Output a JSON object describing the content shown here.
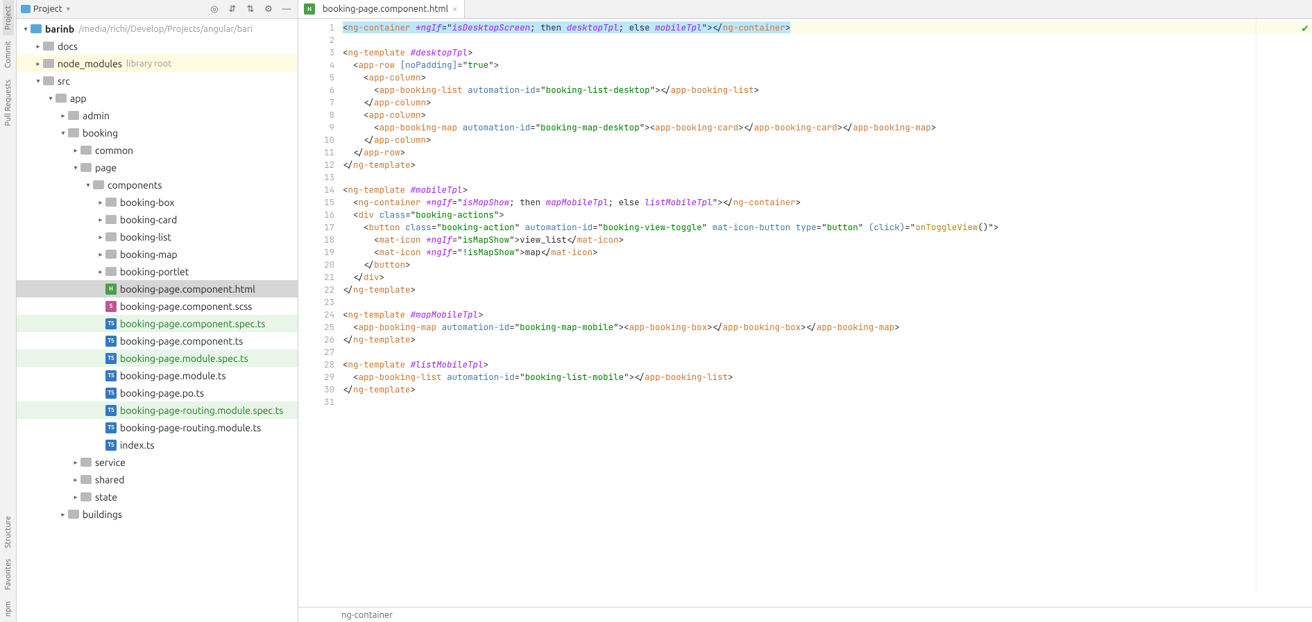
{
  "rail": {
    "top": [
      "Project",
      "Commit",
      "Pull Requests"
    ],
    "bottom": [
      "Structure",
      "Favorites",
      "npm"
    ]
  },
  "panel": {
    "title": "Project"
  },
  "tree": {
    "root": {
      "name": "barinb",
      "path": "/media/richi/Develop/Projects/angular/bari"
    },
    "docs": "docs",
    "node_modules": "node_modules",
    "node_modules_hint": "library root",
    "src": "src",
    "app": "app",
    "admin": "admin",
    "booking": "booking",
    "common": "common",
    "page": "page",
    "components": "components",
    "comp_items": [
      "booking-box",
      "booking-card",
      "booking-list",
      "booking-map",
      "booking-portlet"
    ],
    "files": [
      {
        "n": "booking-page.component.html",
        "t": "html",
        "sel": true
      },
      {
        "n": "booking-page.component.scss",
        "t": "scss"
      },
      {
        "n": "booking-page.component.spec.ts",
        "t": "ts",
        "g": true
      },
      {
        "n": "booking-page.component.ts",
        "t": "ts"
      },
      {
        "n": "booking-page.module.spec.ts",
        "t": "ts",
        "g": true
      },
      {
        "n": "booking-page.module.ts",
        "t": "ts"
      },
      {
        "n": "booking-page.po.ts",
        "t": "ts"
      },
      {
        "n": "booking-page-routing.module.spec.ts",
        "t": "ts",
        "g": true
      },
      {
        "n": "booking-page-routing.module.ts",
        "t": "ts"
      },
      {
        "n": "index.ts",
        "t": "ts"
      }
    ],
    "service": "service",
    "shared": "shared",
    "state": "state",
    "buildings": "buildings"
  },
  "tab": {
    "name": "booking-page.component.html"
  },
  "breadcrumb": "ng-container",
  "code_lines": 31,
  "code": {
    "l1": {
      "pre": "<",
      "tag": "ng-container",
      "sp": " ",
      "dir": "*ngIf",
      "eq": "=\"",
      "v1": "isDesktopScreen",
      "mid": "; then ",
      "v2": "desktopTpl",
      "mid2": "; else ",
      "v3": "mobileTpl",
      "cl": "\"></",
      "tag2": "ng-container",
      "end": ">"
    },
    "l3": {
      "pre": "<",
      "tag": "ng-template",
      "sp": " ",
      "dir": "#desktopTpl",
      "end": ">"
    },
    "l4": {
      "ind": "  ",
      "pre": "<",
      "tag": "app-row",
      "sp": " ",
      "attr": "[noPadding]",
      "eq": "=\"",
      "str": "true",
      "end": "\">"
    },
    "l5": {
      "ind": "    ",
      "pre": "<",
      "tag": "app-column",
      "end": ">"
    },
    "l6": {
      "ind": "      ",
      "pre": "<",
      "tag": "app-booking-list",
      "sp": " ",
      "attr": "automation-id",
      "eq": "=\"",
      "str": "booking-list-desktop",
      "q": "\"></",
      "tag2": "app-booking-list",
      "end": ">"
    },
    "l7": {
      "ind": "    ",
      "pre": "</",
      "tag": "app-column",
      "end": ">"
    },
    "l8": {
      "ind": "    ",
      "pre": "<",
      "tag": "app-column",
      "end": ">"
    },
    "l9": {
      "ind": "      ",
      "pre": "<",
      "tag": "app-booking-map",
      "sp": " ",
      "attr": "automation-id",
      "eq": "=\"",
      "str": "booking-map-desktop",
      "q": "\"><",
      "tag2": "app-booking-card",
      "mid": "></",
      "tag3": "app-booking-card",
      "mid2": "></",
      "tag4": "app-booking-map",
      "end": ">"
    },
    "l10": {
      "ind": "    ",
      "pre": "</",
      "tag": "app-column",
      "end": ">"
    },
    "l11": {
      "ind": "  ",
      "pre": "</",
      "tag": "app-row",
      "end": ">"
    },
    "l12": {
      "pre": "</",
      "tag": "ng-template",
      "end": ">"
    },
    "l14": {
      "pre": "<",
      "tag": "ng-template",
      "sp": " ",
      "dir": "#mobileTpl",
      "end": ">"
    },
    "l15": {
      "ind": "  ",
      "pre": "<",
      "tag": "ng-container",
      "sp": " ",
      "dir": "*ngIf",
      "eq": "=\"",
      "v1": "isMapShow",
      "mid": "; then ",
      "v2": "mapMobileTpl",
      "mid2": "; else ",
      "v3": "listMobileTpl",
      "cl": "\"></",
      "tag2": "ng-container",
      "end": ">"
    },
    "l16": {
      "ind": "  ",
      "pre": "<",
      "tag": "div",
      "sp": " ",
      "attr": "class",
      "eq": "=\"",
      "str": "booking-actions",
      "end": "\">"
    },
    "l17": {
      "ind": "    ",
      "pre": "<",
      "tag": "button",
      "sp": " ",
      "attr": "class",
      "eq": "=\"",
      "str": "booking-action",
      "q": "\" ",
      "attr2": "automation-id",
      "eq2": "=\"",
      "str2": "booking-view-toggle",
      "q2": "\" ",
      "attr3": "mat-icon-button",
      "sp2": " ",
      "attr4": "type",
      "eq3": "=\"",
      "str3": "button",
      "q3": "\" ",
      "attr5": "(click)",
      "eq4": "=\"",
      "func": "onToggleView",
      "paren": "()\"",
      "end": ">"
    },
    "l18": {
      "ind": "      ",
      "pre": "<",
      "tag": "mat-icon",
      "sp": " ",
      "dir": "*ngIf",
      "eq": "=\"",
      "str": "isMapShow",
      "q": "\">",
      "txt": "view_list",
      "cl": "</",
      "tag2": "mat-icon",
      "end": ">"
    },
    "l19": {
      "ind": "      ",
      "pre": "<",
      "tag": "mat-icon",
      "sp": " ",
      "dir": "*ngIf",
      "eq": "=\"",
      "str": "!isMapShow",
      "q": "\">",
      "txt": "map",
      "cl": "</",
      "tag2": "mat-icon",
      "end": ">"
    },
    "l20": {
      "ind": "    ",
      "pre": "</",
      "tag": "button",
      "end": ">"
    },
    "l21": {
      "ind": "  ",
      "pre": "</",
      "tag": "div",
      "end": ">"
    },
    "l22": {
      "pre": "</",
      "tag": "ng-template",
      "end": ">"
    },
    "l24": {
      "pre": "<",
      "tag": "ng-template",
      "sp": " ",
      "dir": "#mapMobileTpl",
      "end": ">"
    },
    "l25": {
      "ind": "  ",
      "pre": "<",
      "tag": "app-booking-map",
      "sp": " ",
      "attr": "automation-id",
      "eq": "=\"",
      "str": "booking-map-mobile",
      "q": "\"><",
      "tag2": "app-booking-box",
      "mid": "></",
      "tag3": "app-booking-box",
      "mid2": "></",
      "tag4": "app-booking-map",
      "end": ">"
    },
    "l26": {
      "pre": "</",
      "tag": "ng-template",
      "end": ">"
    },
    "l28": {
      "pre": "<",
      "tag": "ng-template",
      "sp": " ",
      "dir": "#listMobileTpl",
      "end": ">"
    },
    "l29": {
      "ind": "  ",
      "pre": "<",
      "tag": "app-booking-list",
      "sp": " ",
      "attr": "automation-id",
      "eq": "=\"",
      "str": "booking-list-mobile",
      "q": "\"></",
      "tag2": "app-booking-list",
      "end": ">"
    },
    "l30": {
      "pre": "</",
      "tag": "ng-template",
      "end": ">"
    }
  }
}
